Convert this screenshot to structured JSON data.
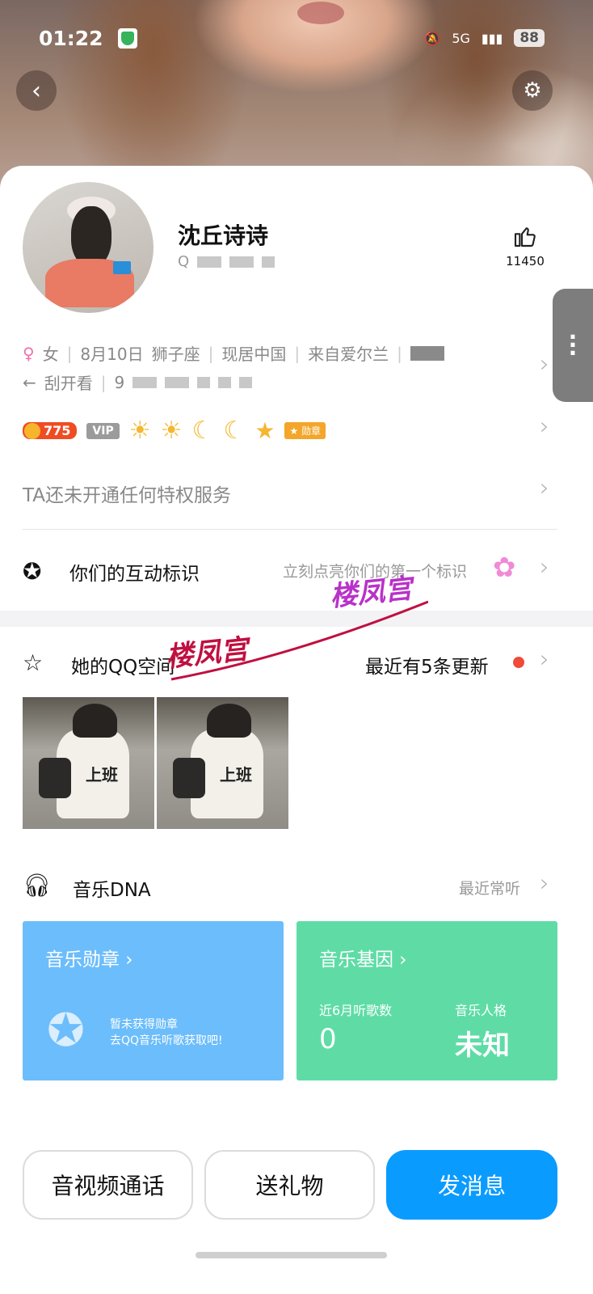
{
  "status_bar": {
    "time": "01:22",
    "network": "5G",
    "battery": "88"
  },
  "profile": {
    "name": "沈丘诗诗",
    "qq_prefix": "Q",
    "likes": "11450"
  },
  "info": {
    "gender_symbol": "♀",
    "gender": "女",
    "birthday": "8月10日",
    "zodiac": "狮子座",
    "residence": "现居中国",
    "hometown": "来自爱尔兰",
    "scratch_arrow": "←",
    "scratch": "刮开看",
    "line2_prefix": "9"
  },
  "badges": {
    "level_points": "775",
    "vip": "VIP",
    "medal_label": "勋章"
  },
  "privilege": {
    "text": "TA还未开通任何特权服务"
  },
  "interaction": {
    "title": "你们的互动标识",
    "hint": "立刻点亮你们的第一个标识"
  },
  "qzone": {
    "title": "她的QQ空间",
    "update_text": "最近有5条更新",
    "photo_caption": "上班"
  },
  "watermark": {
    "text1": "楼凤宫",
    "text2": "楼凤宫"
  },
  "music": {
    "title": "音乐DNA",
    "recent": "最近常听",
    "medal_card": {
      "title": "音乐勋章",
      "line1": "暂未获得勋章",
      "line2": "去QQ音乐听歌获取吧!",
      "color": "#6cbdfb"
    },
    "gene_card": {
      "title": "音乐基因",
      "count_label": "近6月听歌数",
      "count": "0",
      "persona_label": "音乐人格",
      "persona": "未知",
      "color": "#5fdca6"
    }
  },
  "actions": {
    "call": "音视频通话",
    "gift": "送礼物",
    "message": "发消息"
  },
  "colors": {
    "primary": "#0a9bff",
    "dot": "#f04a3a"
  }
}
